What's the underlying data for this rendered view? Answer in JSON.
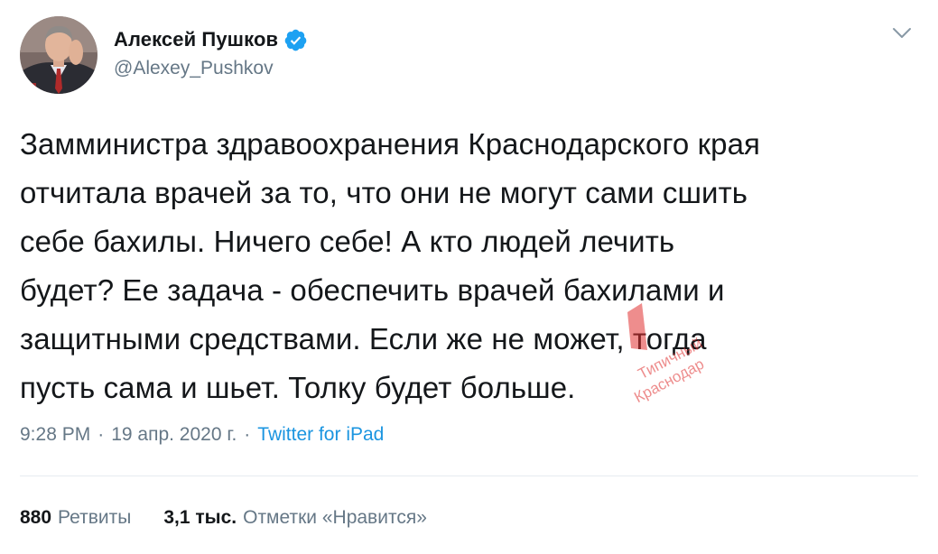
{
  "author": {
    "name": "Алексей Пушков",
    "handle": "@Alexey_Pushkov",
    "verified": true
  },
  "tweet": {
    "text": "Замминистра здравоохранения Краснодарского края\nотчитала врачей за то, что они не могут сами сшить\nсебе бахилы. Ничего себе! А кто людей лечить\nбудет? Ее задача - обеспечить врачей бахилами и\nзащитными средствами. Если же не может, тогда\nпусть сама и шьет. Толку будет больше."
  },
  "meta": {
    "time": "9:28 PM",
    "separator": "·",
    "date": "19 апр. 2020 г.",
    "source": "Twitter for iPad"
  },
  "stats": {
    "retweets_count": "880",
    "retweets_label": "Ретвиты",
    "likes_count": "3,1 тыс.",
    "likes_label": "Отметки «Нравится»"
  },
  "watermark": {
    "line1": "Типичный",
    "line2": "Краснодар"
  },
  "colors": {
    "text": "#14171a",
    "secondary": "#657786",
    "link": "#1b95e0",
    "verified": "#1da1f2",
    "divider": "#e6ecf0",
    "watermark": "#e03030"
  },
  "icons": {
    "verified": "verified-badge-icon",
    "menu": "chevron-down-icon"
  }
}
